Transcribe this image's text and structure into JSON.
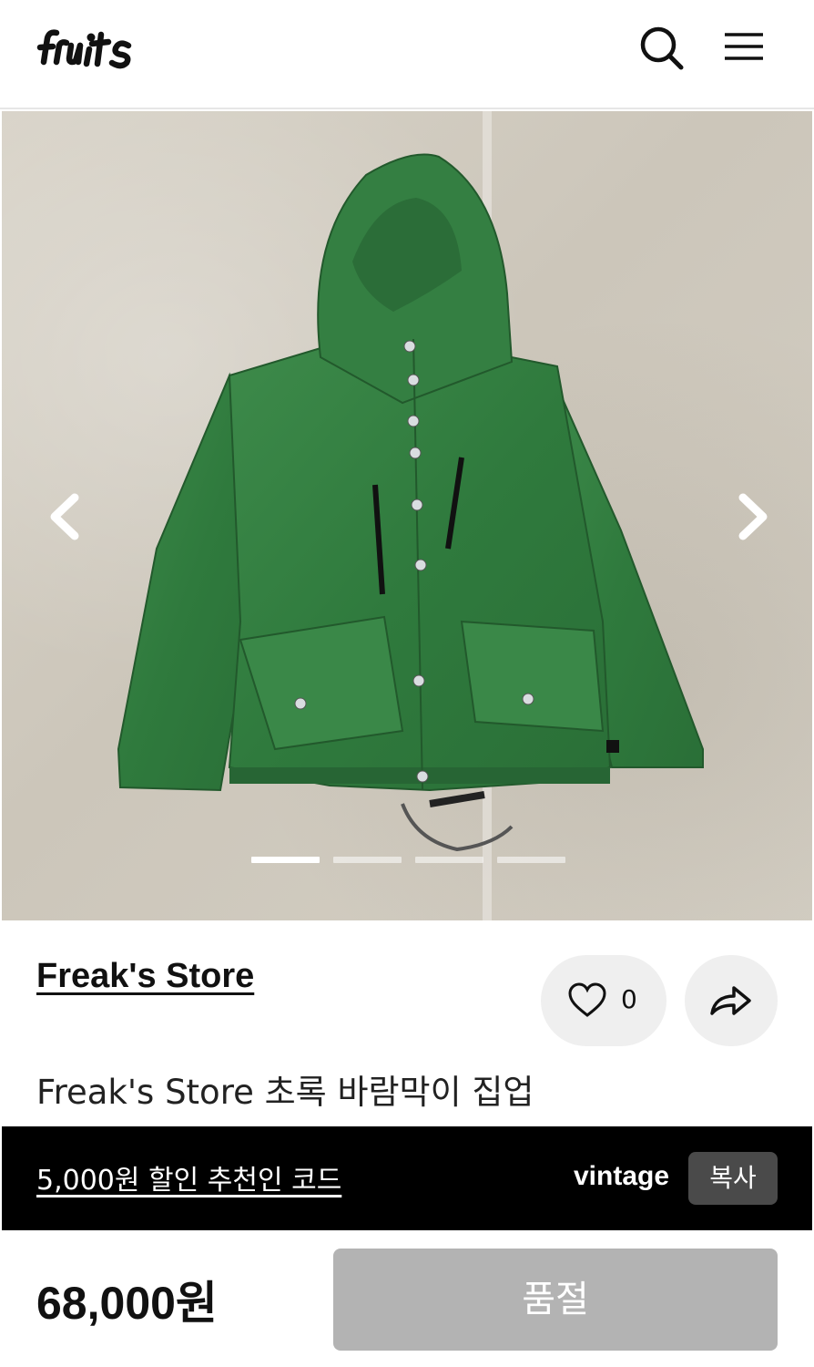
{
  "header": {
    "logo_text": "fruits",
    "search_icon": "search-icon",
    "menu_icon": "hamburger-menu-icon"
  },
  "gallery": {
    "image_subject": "green-hooded-windbreaker-jacket",
    "prev_icon": "chevron-left-icon",
    "next_icon": "chevron-right-icon",
    "slide_count": 4,
    "active_slide": 1
  },
  "store": {
    "name": "Freak's Store"
  },
  "actions": {
    "like_icon": "heart-icon",
    "like_count": "0",
    "share_icon": "share-arrow-icon"
  },
  "product": {
    "title": "Freak's Store 초록 바람막이 집업"
  },
  "promo": {
    "link_text": "5,000원 할인 추천인 코드",
    "code": "vintage",
    "copy_label": "복사"
  },
  "purchase": {
    "price": "68,000원",
    "status_label": "품절"
  },
  "colors": {
    "promo_bg": "#000000",
    "button_bg": "#efefef",
    "soldout_bg": "#b3b3b3",
    "copy_bg": "#4a4a4a"
  }
}
